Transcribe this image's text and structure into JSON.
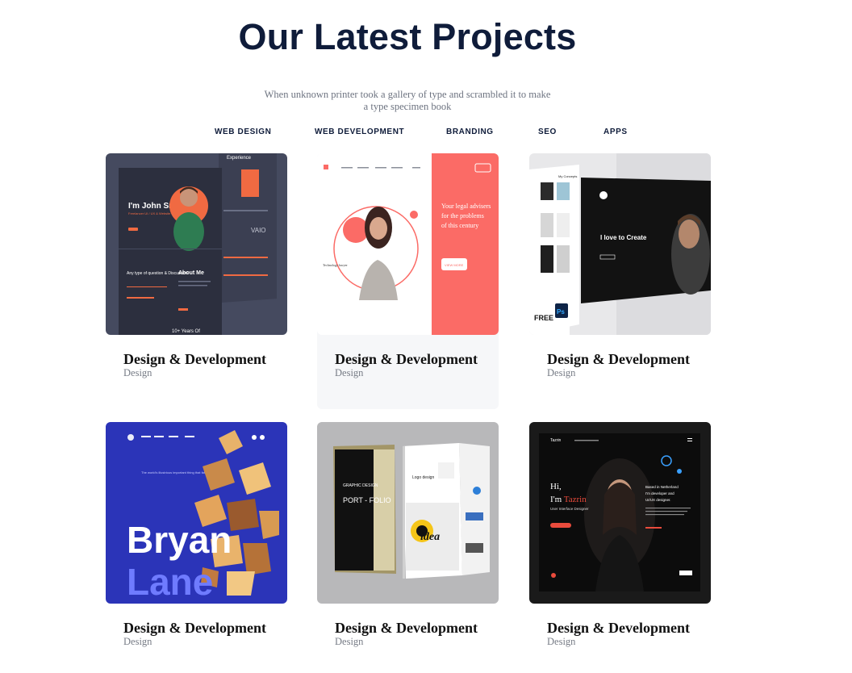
{
  "section": {
    "title": "Our Latest Projects",
    "subtitle": "When unknown printer took a gallery of type and scrambled it to make a type specimen book"
  },
  "filters": [
    "WEB DESIGN",
    "WEB DEVELOPMENT",
    "BRANDING",
    "SEO",
    "APPS"
  ],
  "projects": [
    {
      "title": "Design & Development",
      "category": "Design",
      "thumb": {
        "name": "John Smith",
        "heading": "I'm John Smith",
        "tagline": "Freelancer UI / UX & Website Designer",
        "about": "About Me",
        "question": "Any type of question & Discussion",
        "years": "10+ Years Of",
        "experience": "Experience",
        "brand": "VAIO"
      }
    },
    {
      "title": "Design & Development",
      "category": "Design",
      "thumb": {
        "headline": "Your legal advisers for the problems of this century",
        "role": "Technology lawyer",
        "button": "VIEW MORE"
      }
    },
    {
      "title": "Design & Development",
      "category": "Design",
      "thumb": {
        "label": "My Concepts",
        "headline": "I love to Create",
        "badge": "FREE",
        "app": "Ps"
      }
    },
    {
      "title": "Design & Development",
      "category": "Design",
      "thumb": {
        "line1": "Bryan",
        "line2": "Lane",
        "tagline": "The world's illustrious important thing that fall possesses."
      }
    },
    {
      "title": "Design & Development",
      "category": "Design",
      "thumb": {
        "cover1": "GRAPHIC DESIGN",
        "cover2": "PORT - FOLIO",
        "idea": "idea",
        "logo": "Logo design"
      }
    },
    {
      "title": "Design & Development",
      "category": "Design",
      "thumb": {
        "greeting": "Hi,",
        "name": "I'm Tazrin",
        "role": "User Interface Designer",
        "brand": "Tazrin",
        "bio": "Based in Netherland I'm developer and UI/UX designer."
      }
    }
  ],
  "colors": {
    "heading": "#0f1c3a",
    "coral": "#fb6b66",
    "navy": "#2b34b8",
    "dark": "#111111",
    "accent": "#e94b3c"
  }
}
